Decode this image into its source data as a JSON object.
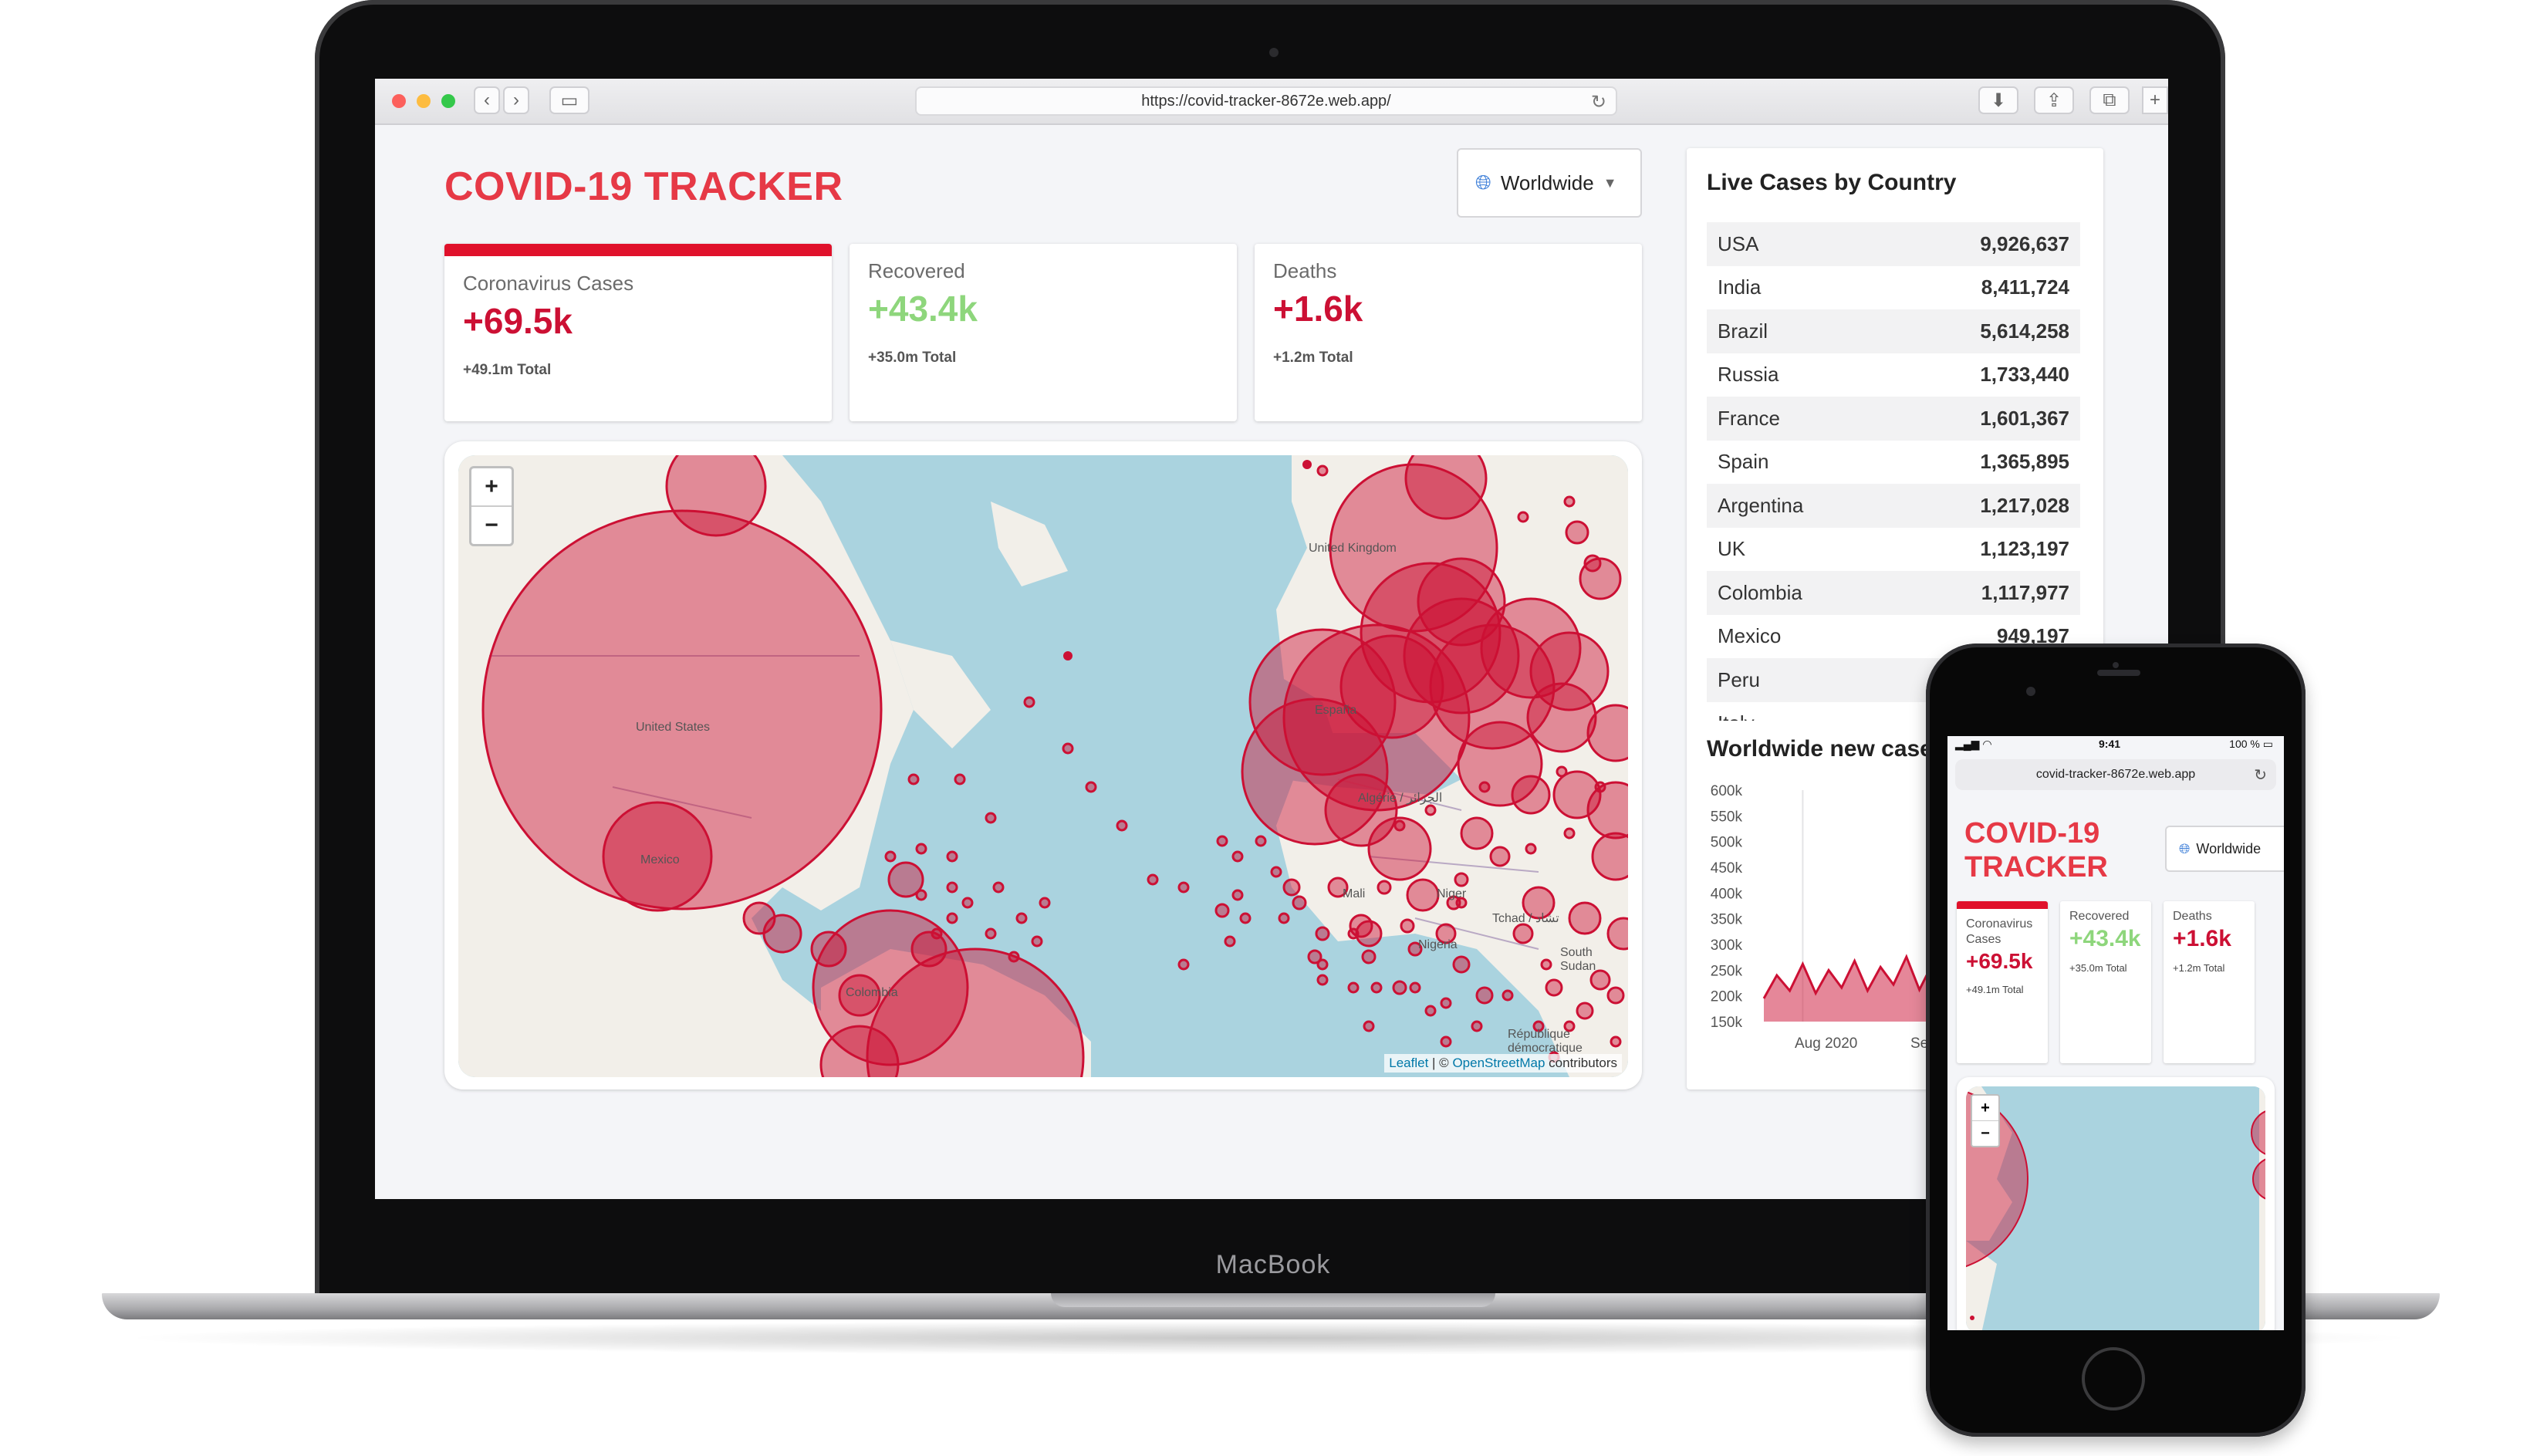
{
  "laptop": {
    "brand": "MacBook",
    "browser": {
      "url": "https://covid-tracker-8672e.web.app/",
      "back_icon": "chevron-left-icon",
      "forward_icon": "chevron-right-icon",
      "sidebar_icon": "sidebar-icon",
      "reload_icon": "reload-icon"
    }
  },
  "app": {
    "title": "COVID-19 TRACKER",
    "country_select": {
      "value": "Worldwide",
      "icon": "globe-icon"
    },
    "stats": [
      {
        "title": "Coronavirus Cases",
        "value": "+69.5k",
        "total": "+49.1m Total",
        "color": "#cc1034",
        "active": true
      },
      {
        "title": "Recovered",
        "value": "+43.4k",
        "total": "+35.0m Total",
        "color": "#7dd71d",
        "active": false
      },
      {
        "title": "Deaths",
        "value": "+1.6k",
        "total": "+1.2m Total",
        "color": "#cc1034",
        "active": false
      }
    ],
    "map": {
      "labels": [
        "United States",
        "Mexico",
        "Colombia",
        "United Kingdom",
        "España",
        "Mali",
        "Niger",
        "Nigeria",
        "Algérie / الجزائر",
        "South Sudan",
        "République démocratique",
        "Tchad / تشاد"
      ],
      "attribution_leaflet": "Leaflet",
      "attribution_sep": " | © ",
      "attribution_osm": "OpenStreetMap",
      "attribution_rest": " contributors",
      "zoom_in": "+",
      "zoom_out": "−"
    },
    "live_cases": {
      "title": "Live Cases by Country",
      "rows": [
        {
          "country": "USA",
          "cases": "9,926,637"
        },
        {
          "country": "India",
          "cases": "8,411,724"
        },
        {
          "country": "Brazil",
          "cases": "5,614,258"
        },
        {
          "country": "Russia",
          "cases": "1,733,440"
        },
        {
          "country": "France",
          "cases": "1,601,367"
        },
        {
          "country": "Spain",
          "cases": "1,365,895"
        },
        {
          "country": "Argentina",
          "cases": "1,217,028"
        },
        {
          "country": "UK",
          "cases": "1,123,197"
        },
        {
          "country": "Colombia",
          "cases": "1,117,977"
        },
        {
          "country": "Mexico",
          "cases": "949,197"
        },
        {
          "country": "Peru",
          "cases": ""
        },
        {
          "country": "Italy",
          "cases": ""
        }
      ]
    },
    "chart_title": "Worldwide new cases"
  },
  "phone": {
    "status": {
      "time": "9:41",
      "battery": "100 %"
    },
    "url": "covid-tracker-8672e.web.app",
    "title": "COVID-19 TRACKER",
    "select": "Worldwide"
  },
  "chart_data": {
    "type": "area",
    "title": "Worldwide new cases",
    "xlabel": "",
    "ylabel": "",
    "y_ticks": [
      "600k",
      "550k",
      "500k",
      "450k",
      "400k",
      "350k",
      "300k",
      "250k",
      "200k",
      "150k"
    ],
    "x_ticks": [
      "Aug 2020",
      "Sep 2020"
    ],
    "ylim": [
      150000,
      600000
    ],
    "color": "#cc1034",
    "values": [
      195000,
      240000,
      210000,
      262000,
      205000,
      250000,
      216000,
      268000,
      210000,
      256000,
      222000,
      276000,
      212000,
      262000,
      226000,
      282000,
      216000,
      268000,
      230000,
      288000,
      222000,
      274000,
      236000,
      294000,
      228000,
      282000
    ]
  }
}
